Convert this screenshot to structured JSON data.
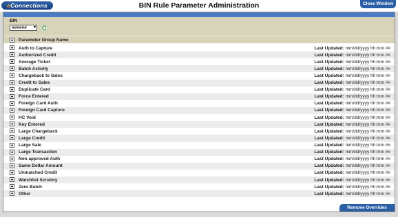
{
  "header": {
    "logo_prefix": "e",
    "logo_text": "Connections",
    "title": "BIN Rule Parameter Administration",
    "close_label": "Close Window"
  },
  "bin": {
    "label": "BIN",
    "selected": "######"
  },
  "group_header": "Parameter Group Name",
  "last_updated_label": "Last Updated:",
  "groups": [
    {
      "name": "Auth to Capture",
      "updated": "mm/dd/yyyy hh:mm ##"
    },
    {
      "name": "Authorized Credit",
      "updated": "mm/dd/yyyy hh:mm ##"
    },
    {
      "name": "Average Ticket",
      "updated": "mm/dd/yyyy hh:mm ##"
    },
    {
      "name": "Batch Activity",
      "updated": "mm/dd/yyyy hh:mm ##"
    },
    {
      "name": "Chargeback to Sales",
      "updated": "mm/dd/yyyy hh:mm ##"
    },
    {
      "name": "Credit to Sales",
      "updated": "mm/dd/yyyy hh:mm ##"
    },
    {
      "name": "Duplicate Card",
      "updated": "mm/dd/yyyy hh:mm ##"
    },
    {
      "name": "Force Entered",
      "updated": "mm/dd/yyyy hh:mm ##"
    },
    {
      "name": "Foreign Card Auth",
      "updated": "mm/dd/yyyy hh:mm ##"
    },
    {
      "name": "Foreign Card Capture",
      "updated": "mm/dd/yyyy hh:mm ##"
    },
    {
      "name": "HC Void",
      "updated": "mm/dd/yyyy hh:mm ##"
    },
    {
      "name": "Key Entered",
      "updated": "mm/dd/yyyy hh:mm ##"
    },
    {
      "name": "Large Chargeback",
      "updated": "mm/dd/yyyy hh:mm ##"
    },
    {
      "name": "Large Credit",
      "updated": "mm/dd/yyyy hh:mm ##"
    },
    {
      "name": "Large Sale",
      "updated": "mm/dd/yyyy hh:mm ##"
    },
    {
      "name": "Large Transaction",
      "updated": "mm/dd/yyyy hh:mm ##"
    },
    {
      "name": "Non approved Auth",
      "updated": "mm/dd/yyyy hh:mm ##"
    },
    {
      "name": "Same Dollar Amount",
      "updated": "mm/dd/yyyy hh:mm ##"
    },
    {
      "name": "Unmatched Credit",
      "updated": "mm/dd/yyyy hh:mm ##"
    },
    {
      "name": "Watchlist Scrutiny",
      "updated": "mm/dd/yyyy hh:mm ##"
    },
    {
      "name": "Zero Batch",
      "updated": "mm/dd/yyyy hh:mm ##"
    },
    {
      "name": "Other",
      "updated": "mm/dd/yyyy hh:mm ##"
    }
  ],
  "remove_label": "Remove Overrides",
  "colors": {
    "accent_blue": "#2b5fa5",
    "header_band": "#d8d4ba",
    "logo_orange": "#f5a623"
  }
}
